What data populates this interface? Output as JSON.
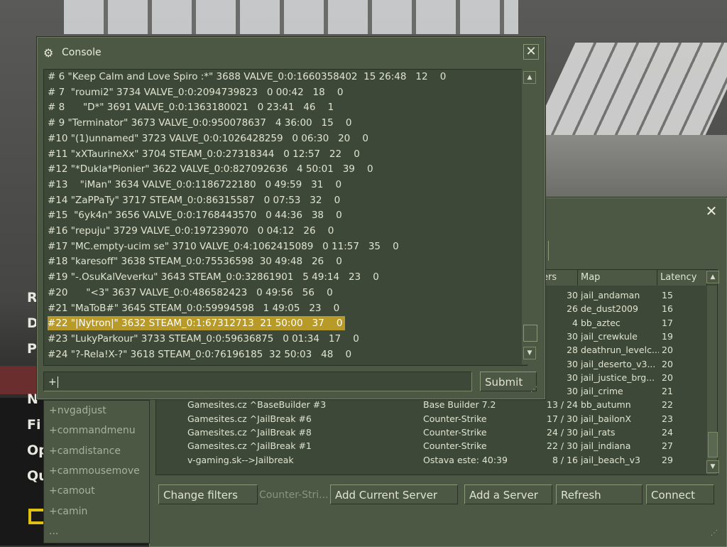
{
  "background": {
    "menu_items": [
      "R",
      "D",
      "P",
      "N",
      "Fi",
      "Op",
      "Qu"
    ]
  },
  "console": {
    "title": "Console",
    "close_label": "✕",
    "log": [
      "# 6 \"Keep Calm and Love Spiro :*\" 3688 VALVE_0:0:1660358402  15 26:48   12    0",
      "# 7  \"roumi2\" 3734 VALVE_0:0:2094739823   0 00:42   18    0",
      "# 8      \"D*\" 3691 VALVE_0:0:1363180021   0 23:41   46    1",
      "# 9 \"Terminator\" 3673 VALVE_0:0:950078637   4 36:00   15    0",
      "#10 \"(1)unnamed\" 3723 VALVE_0:0:1026428259   0 06:30   20    0",
      "#11 \"xXTaurineXx\" 3704 STEAM_0:0:27318344   0 12:57   22    0",
      "#12 \"*Dukla*Pionier\" 3622 VALVE_0:0:827092636   4 50:01   39    0",
      "#13    \"iMan\" 3634 VALVE_0:0:1186722180   0 49:59   31    0",
      "#14 \"ZaPPaTy\" 3717 STEAM_0:0:86315587   0 07:53   32    0",
      "#15  \"6yk4n\" 3656 VALVE_0:0:1768443570   0 44:36   38    0",
      "#16 \"repuju\" 3729 VALVE_0:0:197239070   0 04:12   26    0",
      "#17 \"MC.empty-ucim se\" 3710 VALVE_0:4:1062415089   0 11:57   35    0",
      "#18 \"karesoff\" 3638 STEAM_0:0:75536598  30 49:48   26    0",
      "#19 \"-.OsuKalVeverku\" 3643 STEAM_0:0:32861901   5 49:14   23    0",
      "#20      \"<3\" 3637 VALVE_0:0:486582423   0 49:56   56    0",
      "#21 \"MaToB#\" 3645 STEAM_0:0:59994598   1 49:05   23    0",
      "#22 \"|Nytron|\" 3632 STEAM_0:1:67312713  21 50:00   37    0",
      "#23 \"LukyParkour\" 3733 STEAM_0:0:59636875   0 01:34   17    0",
      "#24 \"?-Rela!X-?\" 3618 STEAM_0:0:76196185  32 50:03   48    0"
    ],
    "highlighted_index": 16,
    "input_value": "+",
    "submit_label": "Submit"
  },
  "autocomplete": {
    "items": [
      "+nvgadjust",
      "+commandmenu",
      "+camdistance",
      "+cammousemove",
      "+camout",
      "+camin",
      "..."
    ]
  },
  "server_browser": {
    "close_label": "✕",
    "columns": {
      "players": "ers",
      "map": "Map",
      "latency": "Latency"
    },
    "rows": [
      {
        "name": "",
        "game": "",
        "players": "30",
        "map": "jail_andaman",
        "latency": "15"
      },
      {
        "name": "",
        "game": "",
        "players": "26",
        "map": "de_dust2009",
        "latency": "16"
      },
      {
        "name": "",
        "game": "",
        "players": "4",
        "map": "bb_aztec",
        "latency": "17"
      },
      {
        "name": "",
        "game": "",
        "players": "30",
        "map": "jail_crewkule",
        "latency": "19"
      },
      {
        "name": "",
        "game": "",
        "players": "28",
        "map": "deathrun_levelc...",
        "latency": "20"
      },
      {
        "name": "",
        "game": "",
        "players": "30",
        "map": "jail_deserto_v3...",
        "latency": "20"
      },
      {
        "name": "",
        "game": "",
        "players": "30",
        "map": "jail_justice_brg...",
        "latency": "20"
      },
      {
        "name": "",
        "game": "",
        "players": "30",
        "map": "jail_crime",
        "latency": "21"
      },
      {
        "name": "Gamesites.cz ^BaseBuilder #3",
        "game": "Base Builder 7.2",
        "players": "13 / 24",
        "map": "bb_autumn",
        "latency": "22"
      },
      {
        "name": "Gamesites.cz ^JailBreak #6",
        "game": "Counter-Strike",
        "players": "17 / 30",
        "map": "jail_bailonX",
        "latency": "23"
      },
      {
        "name": "Gamesites.cz ^JailBreak #8",
        "game": "Counter-Strike",
        "players": "24 / 30",
        "map": "jail_rats",
        "latency": "24"
      },
      {
        "name": "Gamesites.cz ^JailBreak #1",
        "game": "Counter-Strike",
        "players": "22 / 30",
        "map": "jail_indiana",
        "latency": "27"
      },
      {
        "name": "v-gaming.sk-->Jailbreak",
        "game": "Ostava este: 40:39",
        "players": "8 / 16",
        "map": "jail_beach_v3",
        "latency": "29"
      }
    ],
    "buttons": {
      "change_filters": "Change filters",
      "filter_label": "Counter-Stri...",
      "add_current": "Add Current Server",
      "add_server": "Add a Server",
      "refresh": "Refresh",
      "connect": "Connect"
    }
  },
  "colors": {
    "panel": "#4c5844",
    "panel_dark": "#3e4838",
    "highlight": "#b89a28"
  },
  "icons": {
    "console": "steam-icon",
    "close": "close-icon",
    "scroll_up": "arrow-up-icon",
    "scroll_down": "arrow-down-icon"
  }
}
